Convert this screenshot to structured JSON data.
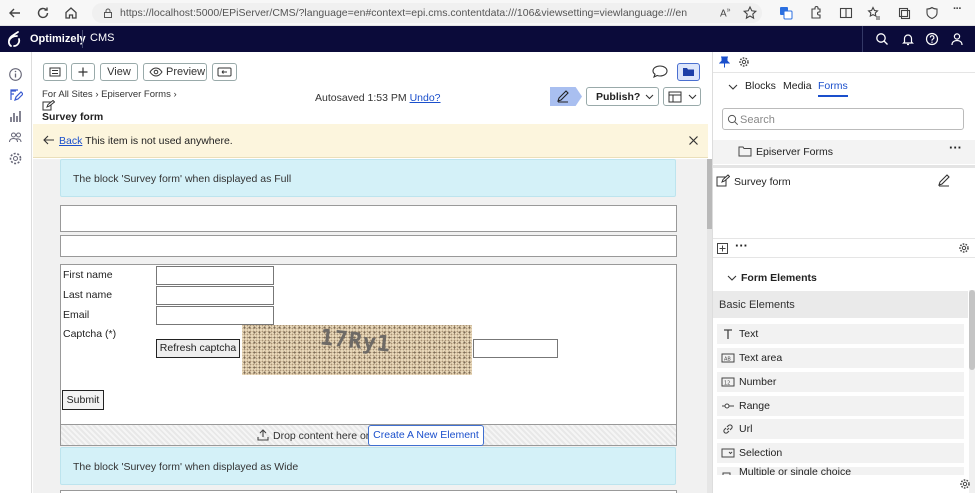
{
  "browser": {
    "url": "https://localhost:5000/EPiServer/CMS/?language=en#context=epi.cms.contentdata:///106&viewsetting=viewlanguage:///en"
  },
  "cms_header": {
    "brand": "Optimizely",
    "section": "CMS"
  },
  "toolbar": {
    "view_label": "View",
    "preview_label": "Preview",
    "publish_label": "Publish?",
    "autosaved_text": "Autosaved 1:53 PM",
    "undo_label": "Undo?"
  },
  "breadcrumb": {
    "items": [
      "For All Sites",
      "Episerver Forms"
    ]
  },
  "page_title": "Survey form",
  "notice": {
    "back_label": "Back",
    "message": "This item is not used anywhere."
  },
  "content": {
    "full_block_text": "The block 'Survey form' when displayed as Full",
    "wide_block_text": "The block 'Survey form' when displayed as Wide",
    "form": {
      "fields": [
        "First name",
        "Last name",
        "Email"
      ],
      "captcha_label": "Captcha (*)",
      "refresh_captcha_label": "Refresh captcha",
      "captcha_text": "17Ry1",
      "submit_label": "Submit"
    },
    "dropzone_text": "Drop content here or",
    "create_element_label": "Create A New Element"
  },
  "right_panel": {
    "tabs": [
      "Blocks",
      "Media",
      "Forms"
    ],
    "active_tab": "Forms",
    "search_placeholder": "Search",
    "folder_name": "Episerver Forms",
    "item_name": "Survey form",
    "form_elements_title": "Form Elements",
    "basic_elements_title": "Basic Elements",
    "elements": [
      {
        "label": "Text",
        "icon": "text-icon"
      },
      {
        "label": "Text area",
        "icon": "textarea-icon"
      },
      {
        "label": "Number",
        "icon": "number-icon"
      },
      {
        "label": "Range",
        "icon": "range-icon"
      },
      {
        "label": "Url",
        "icon": "link-icon"
      },
      {
        "label": "Selection",
        "icon": "selection-icon"
      },
      {
        "label": "Multiple or single choice",
        "icon": "choice-icon"
      }
    ]
  },
  "colors": {
    "header_bg": "#0b0b3a",
    "accent": "#1a4fcc",
    "info_bg": "#d4f1f8",
    "notice_bg": "#fcf5dd",
    "publish_bg": "#a9bff0"
  }
}
